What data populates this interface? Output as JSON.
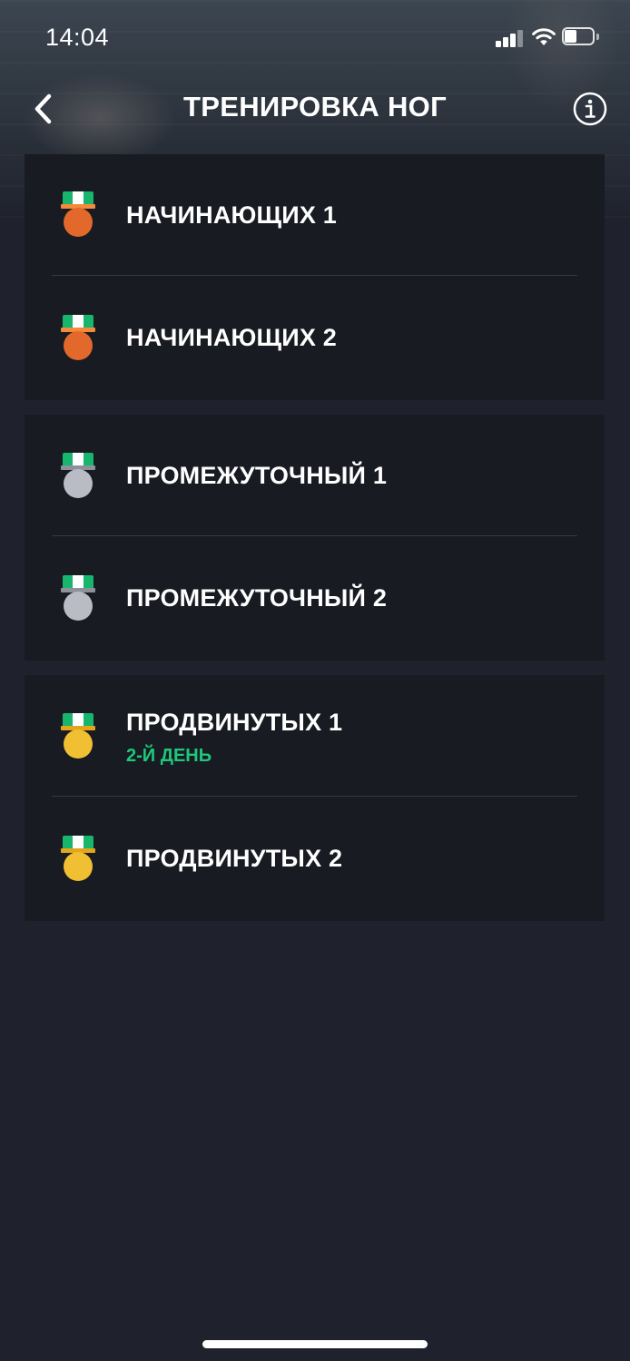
{
  "status_bar": {
    "time": "14:04"
  },
  "nav": {
    "title": "ТРЕНИРОВКА НОГ"
  },
  "groups": [
    {
      "medal": "bronze-medal",
      "items": [
        {
          "label": "НАЧИНАЮЩИХ 1",
          "subtitle": ""
        },
        {
          "label": "НАЧИНАЮЩИХ 2",
          "subtitle": ""
        }
      ]
    },
    {
      "medal": "silver-medal",
      "items": [
        {
          "label": "ПРОМЕЖУТОЧНЫЙ 1",
          "subtitle": ""
        },
        {
          "label": "ПРОМЕЖУТОЧНЫЙ 2",
          "subtitle": ""
        }
      ]
    },
    {
      "medal": "gold-medal",
      "items": [
        {
          "label": "ПРОДВИНУТЫХ 1",
          "subtitle": "2-Й ДЕНЬ"
        },
        {
          "label": "ПРОДВИНУТЫХ 2",
          "subtitle": ""
        }
      ]
    }
  ],
  "colors": {
    "background": "#1f222c",
    "card": "#181b22",
    "accent_green": "#1fc77a",
    "ribbon_green": "#18b56c",
    "bronze": "#e2692b",
    "silver": "#b9bcc4",
    "gold": "#f0c032"
  }
}
